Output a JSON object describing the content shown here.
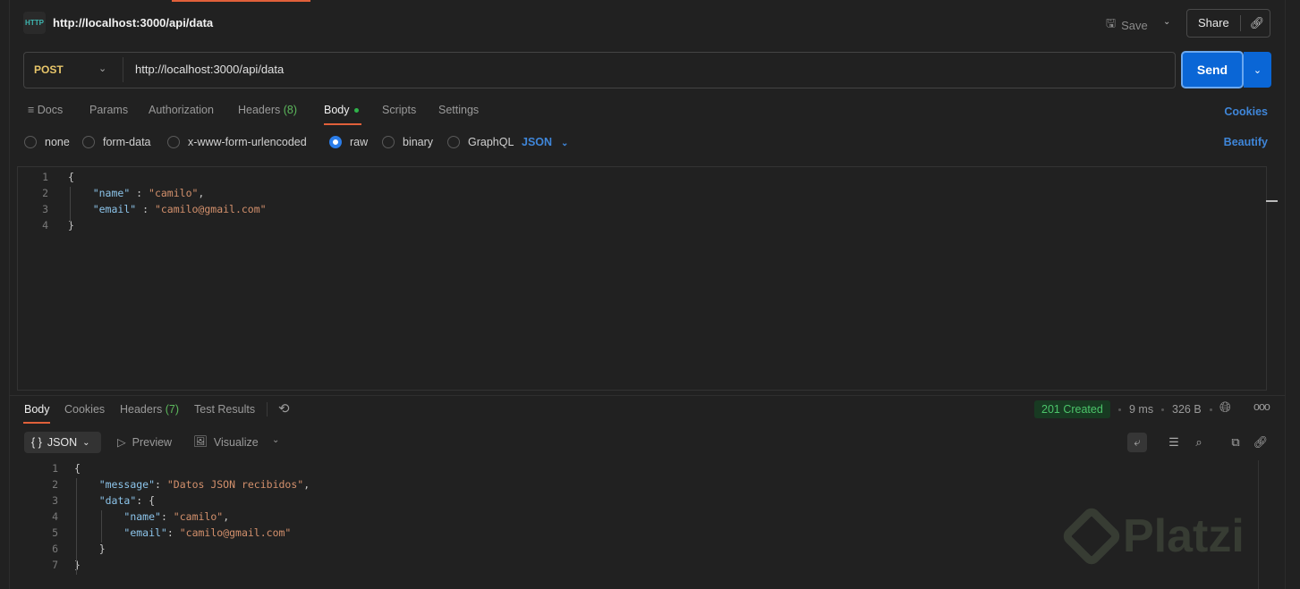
{
  "header": {
    "title": "http://localhost:3000/api/data",
    "http_icon": "HTTP",
    "save_label": "Save",
    "share_label": "Share"
  },
  "request": {
    "method": "POST",
    "url": "http://localhost:3000/api/data",
    "send_label": "Send"
  },
  "tabs": [
    {
      "label": "Docs"
    },
    {
      "label": "Params"
    },
    {
      "label": "Authorization"
    },
    {
      "label": "Headers",
      "count": "(8)"
    },
    {
      "label": "Body"
    },
    {
      "label": "Scripts"
    },
    {
      "label": "Settings"
    }
  ],
  "cookies_link": "Cookies",
  "body_types": [
    "none",
    "form-data",
    "x-www-form-urlencoded",
    "raw",
    "binary",
    "GraphQL"
  ],
  "selected_body_type": "raw",
  "raw_format": "JSON",
  "beautify_label": "Beautify",
  "request_body": [
    [
      {
        "t": "{",
        "c": ""
      }
    ],
    [
      {
        "t": "    ",
        "c": ""
      },
      {
        "t": "\"name\"",
        "c": "k"
      },
      {
        "t": " : ",
        "c": ""
      },
      {
        "t": "\"camilo\"",
        "c": "s"
      },
      {
        "t": ",",
        "c": ""
      }
    ],
    [
      {
        "t": "    ",
        "c": ""
      },
      {
        "t": "\"email\"",
        "c": "k"
      },
      {
        "t": " : ",
        "c": ""
      },
      {
        "t": "\"camilo@gmail.com\"",
        "c": "s"
      }
    ],
    [
      {
        "t": "}",
        "c": ""
      }
    ]
  ],
  "response": {
    "tabs": [
      {
        "label": "Body"
      },
      {
        "label": "Cookies"
      },
      {
        "label": "Headers",
        "count": "(7)"
      },
      {
        "label": "Test Results"
      }
    ],
    "status": "201 Created",
    "time": "9 ms",
    "size": "326 B",
    "format": "JSON",
    "preview_label": "Preview",
    "visualize_label": "Visualize",
    "body": [
      [
        {
          "t": "{",
          "c": ""
        }
      ],
      [
        {
          "t": "    ",
          "c": ""
        },
        {
          "t": "\"message\"",
          "c": "k"
        },
        {
          "t": ": ",
          "c": ""
        },
        {
          "t": "\"Datos JSON recibidos\"",
          "c": "s"
        },
        {
          "t": ",",
          "c": ""
        }
      ],
      [
        {
          "t": "    ",
          "c": ""
        },
        {
          "t": "\"data\"",
          "c": "k"
        },
        {
          "t": ": {",
          "c": ""
        }
      ],
      [
        {
          "t": "        ",
          "c": ""
        },
        {
          "t": "\"name\"",
          "c": "k"
        },
        {
          "t": ": ",
          "c": ""
        },
        {
          "t": "\"camilo\"",
          "c": "s"
        },
        {
          "t": ",",
          "c": ""
        }
      ],
      [
        {
          "t": "        ",
          "c": ""
        },
        {
          "t": "\"email\"",
          "c": "k"
        },
        {
          "t": ": ",
          "c": ""
        },
        {
          "t": "\"camilo@gmail.com\"",
          "c": "s"
        }
      ],
      [
        {
          "t": "    }",
          "c": ""
        }
      ],
      [
        {
          "t": "}",
          "c": ""
        }
      ]
    ]
  },
  "watermark": "Platzi",
  "colors": {
    "accent": "#0a66d6",
    "tab_underline": "#e0603a",
    "success": "#4cc46a",
    "method": "#e8c66a"
  }
}
